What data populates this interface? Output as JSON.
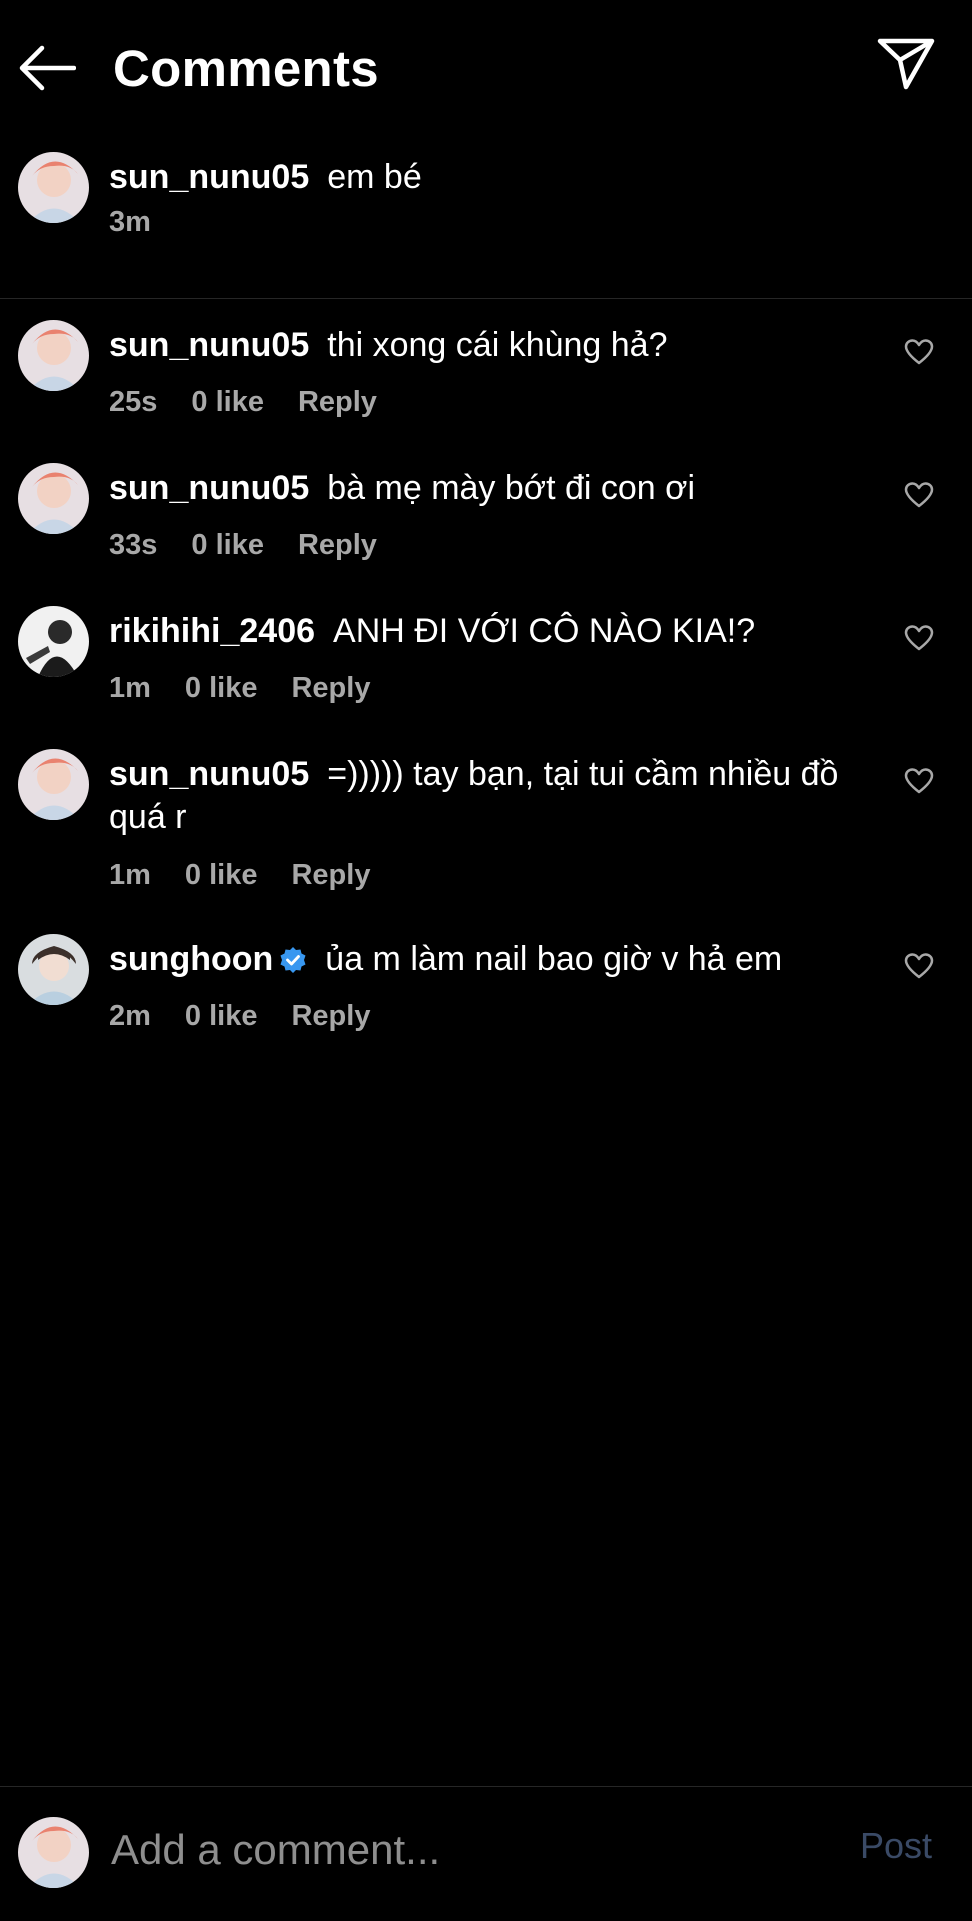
{
  "header": {
    "title": "Comments",
    "back_icon": "arrow-left-icon",
    "share_icon": "paper-plane-icon"
  },
  "caption": {
    "username": "sun_nunu05",
    "text": "em bé",
    "time": "3m"
  },
  "comments": [
    {
      "username": "sun_nunu05",
      "text": "thi xong cái khùng hả?",
      "time": "25s",
      "likes": "0 like",
      "reply": "Reply"
    },
    {
      "username": "sun_nunu05",
      "text": "bà mẹ mày bớt đi con ơi",
      "time": "33s",
      "likes": "0 like",
      "reply": "Reply"
    },
    {
      "username": "rikihihi_2406",
      "text": "ANH ĐI VỚI CÔ NÀO KIA!?",
      "time": "1m",
      "likes": "0 like",
      "reply": "Reply"
    },
    {
      "username": "sun_nunu05",
      "text": "=))))) tay bạn, tại tui cầm nhiều đồ quá r",
      "time": "1m",
      "likes": "0 like",
      "reply": "Reply"
    },
    {
      "username": "sunghoon",
      "verified": true,
      "text": "ủa m làm nail bao giờ v hả em",
      "time": "2m",
      "likes": "0 like",
      "reply": "Reply"
    }
  ],
  "footer": {
    "placeholder": "Add a comment...",
    "post_label": "Post"
  },
  "colors": {
    "background": "#000000",
    "text": "#ffffff",
    "muted": "#a8a8a8",
    "verified": "#3897f0",
    "post_disabled": "#3a4a66",
    "divider": "#262626"
  }
}
